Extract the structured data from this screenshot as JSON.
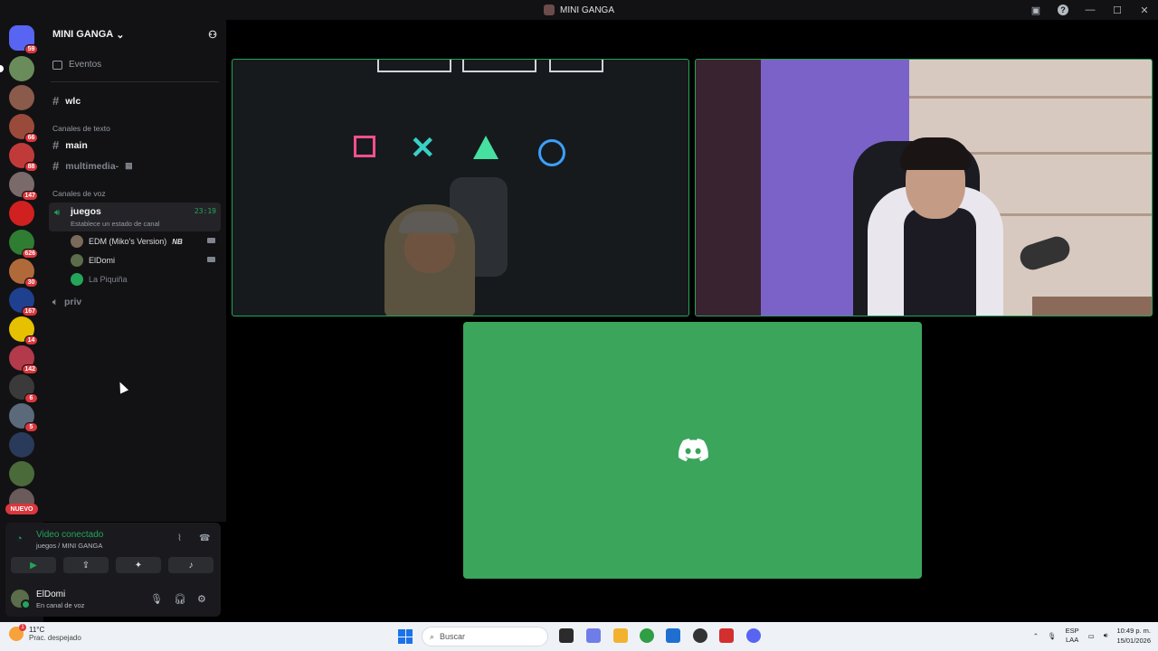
{
  "window": {
    "title": "MINI GANGA"
  },
  "guilds": [
    {
      "name": "direct-messages",
      "badge": "59",
      "color": "#5865f2"
    },
    {
      "name": "server-1",
      "badge": "",
      "color": "#6a8c5a",
      "selected": true
    },
    {
      "name": "server-2",
      "badge": "",
      "color": "#8a5a4a"
    },
    {
      "name": "server-3",
      "badge": "66",
      "color": "#9a4a3a"
    },
    {
      "name": "server-4",
      "badge": "88",
      "color": "#c13a3a"
    },
    {
      "name": "server-5",
      "badge": "147",
      "color": "#7a6a6a"
    },
    {
      "name": "server-6",
      "badge": "",
      "color": "#d02020"
    },
    {
      "name": "server-7",
      "badge": "626",
      "color": "#2e7d32"
    },
    {
      "name": "server-8",
      "badge": "30",
      "color": "#b06a3a"
    },
    {
      "name": "server-9",
      "badge": "167",
      "color": "#1f3f8f"
    },
    {
      "name": "server-10",
      "badge": "14",
      "color": "#e5c100"
    },
    {
      "name": "server-11",
      "badge": "142",
      "color": "#b33a4a"
    },
    {
      "name": "server-12",
      "badge": "6",
      "color": "#3a3a3a"
    },
    {
      "name": "server-13",
      "badge": "5",
      "color": "#5a6a7a"
    },
    {
      "name": "server-14",
      "badge": "",
      "color": "#2a3a5a"
    },
    {
      "name": "server-15",
      "badge": "",
      "color": "#4a6a3a"
    },
    {
      "name": "server-16",
      "badge": "",
      "color": "#6a5a5a"
    }
  ],
  "nuevo_label": "NUEVO",
  "server": {
    "name": "MINI GANGA",
    "events_label": "Eventos",
    "channel_wlc": "wlc",
    "text_category": "Canales de texto",
    "text_channels": [
      "main",
      "multimedia-"
    ],
    "voice_category": "Canales de voz",
    "voice_channel": {
      "name": "juegos",
      "timer": "23:19",
      "status": "Establece un estado de canal",
      "users": [
        {
          "name": "EDM (Miko's Version)",
          "tag": "NB",
          "camera": true
        },
        {
          "name": "ElDomi",
          "camera": true
        },
        {
          "name": "La Piquiña",
          "camera": false
        }
      ]
    },
    "voice_channel_2": "priv"
  },
  "connection": {
    "title": "Video conectado",
    "subtitle": "juegos / MINI GANGA",
    "buttons": [
      "video",
      "screen-share",
      "activities",
      "soundboard"
    ]
  },
  "user": {
    "name": "ElDomi",
    "status": "En canal de voz"
  },
  "taskbar": {
    "temperature": "11°C",
    "weather_desc": "Prac. despejado",
    "weather_badge": "1",
    "search_placeholder": "Buscar",
    "lang_top": "ESP",
    "lang_bottom": "LAA",
    "time": "10:49 p. m.",
    "date": "15/01/2026"
  },
  "colors": {
    "accent_green": "#23a55a",
    "discord_tile": "#3ba55c",
    "badge_red": "#da373c"
  }
}
